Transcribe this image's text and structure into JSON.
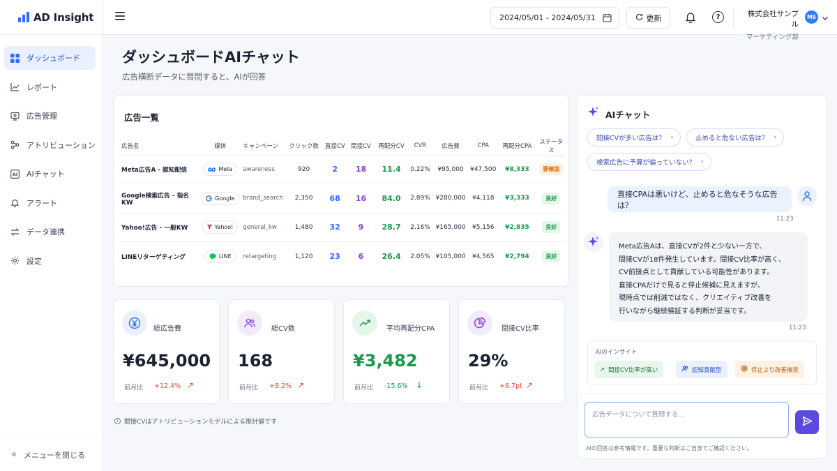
{
  "app": {
    "name": "AD Insight"
  },
  "sidebar": {
    "items": [
      {
        "label": "ダッシュボード",
        "icon": "grid-icon",
        "active": true
      },
      {
        "label": "レポート",
        "icon": "chart-line-icon"
      },
      {
        "label": "広告管理",
        "icon": "monitor-icon"
      },
      {
        "label": "アトリビューション",
        "icon": "network-icon"
      },
      {
        "label": "AIチャット",
        "icon": "ai-icon"
      },
      {
        "label": "アラート",
        "icon": "bell-icon"
      },
      {
        "label": "データ連携",
        "icon": "sync-icon"
      },
      {
        "label": "設定",
        "icon": "gear-icon"
      }
    ],
    "collapse_label": "メニューを閉じる"
  },
  "topbar": {
    "date_range": "2024/05/01 - 2024/05/31",
    "refresh_label": "更新",
    "company": "株式会社サンプル",
    "department": "マーケティング部",
    "avatar_initials": "MS"
  },
  "page": {
    "title": "ダッシュボードAIチャット",
    "subtitle": "広告横断データに質問すると、AIが回答"
  },
  "ad_table": {
    "title": "広告一覧",
    "headers": [
      "広告名",
      "媒体",
      "キャンペーン",
      "クリック数",
      "直接CV",
      "間接CV",
      "再配分CV",
      "CVR",
      "広告費",
      "CPA",
      "再配分CPA",
      "ステータス"
    ],
    "rows": [
      {
        "name": "Meta広告A - 認知配信",
        "media": "Meta",
        "campaign": "awareness",
        "clicks": "920",
        "direct_cv": "2",
        "indirect_cv": "18",
        "realloc_cv": "11.4",
        "cvr": "0.22%",
        "cost": "¥95,000",
        "cpa": "¥47,500",
        "realloc_cpa": "¥8,333",
        "status": "要確認",
        "status_type": "warn"
      },
      {
        "name": "Google検索広告 - 指名KW",
        "media": "Google",
        "campaign": "brand_search",
        "clicks": "2,350",
        "direct_cv": "68",
        "indirect_cv": "16",
        "realloc_cv": "84.0",
        "cvr": "2.89%",
        "cost": "¥280,000",
        "cpa": "¥4,118",
        "realloc_cpa": "¥3,333",
        "status": "良好",
        "status_type": "good"
      },
      {
        "name": "Yahoo!広告 - 一般KW",
        "media": "Yahoo!",
        "campaign": "general_kw",
        "clicks": "1,480",
        "direct_cv": "32",
        "indirect_cv": "9",
        "realloc_cv": "28.7",
        "cvr": "2.16%",
        "cost": "¥165,000",
        "cpa": "¥5,156",
        "realloc_cpa": "¥2,835",
        "status": "良好",
        "status_type": "good"
      },
      {
        "name": "LINEリターゲティング",
        "media": "LINE",
        "campaign": "retargeting",
        "clicks": "1,120",
        "direct_cv": "23",
        "indirect_cv": "6",
        "realloc_cv": "26.4",
        "cvr": "2.05%",
        "cost": "¥105,000",
        "cpa": "¥4,565",
        "realloc_cpa": "¥2,794",
        "status": "良好",
        "status_type": "good"
      }
    ]
  },
  "kpis": [
    {
      "label": "総広告費",
      "value": "¥645,000",
      "compare_label": "前月比",
      "delta": "+12.4%",
      "icon": "yen-icon",
      "color": "#2f6bff"
    },
    {
      "label": "総CV数",
      "value": "168",
      "compare_label": "前月比",
      "delta": "+8.2%",
      "icon": "users-icon",
      "color": "#8b3fd9"
    },
    {
      "label": "平均再配分CPA",
      "value": "¥3,482",
      "compare_label": "前月比",
      "delta": "-15.6%",
      "icon": "trend-up-icon",
      "color": "#1a9a4a"
    },
    {
      "label": "間接CV比率",
      "value": "29%",
      "compare_label": "前月比",
      "delta": "+6.7pt",
      "icon": "pie-icon",
      "color": "#8b3fd9"
    }
  ],
  "note": "間接CVはアトリビューションモデルによる推計値です",
  "chat": {
    "title": "AIチャット",
    "suggestions": [
      "間接CVが多い広告は？",
      "止めると危ない広告は？",
      "検索広告に予算が偏っていない？"
    ],
    "user_message": "直接CPAは悪いけど、止めると危なそうな広告は？",
    "user_time": "11:23",
    "ai_lines": [
      "Meta広告Aは、直接CVが2件と少ない一方で、",
      "間接CVが18件発生しています。間接CV比率が高く、",
      "CV前接点として貢献している可能性があります。",
      "直接CPAだけで見ると停止候補に見えますが、",
      "現時点では削減ではなく、クリエイティブ改善を",
      "行いながら継続検証する判断が妥当です。"
    ],
    "ai_time": "11:23",
    "insight_label": "AIのインサイト",
    "insight_chips": [
      "間接CV比率が高い",
      "認知貢献型",
      "停止より改善推奨"
    ],
    "input_placeholder": "広告データについて質問する...",
    "disclaimer": "AIの回答は参考情報です。重要な判断はご自身でご確認ください。"
  }
}
